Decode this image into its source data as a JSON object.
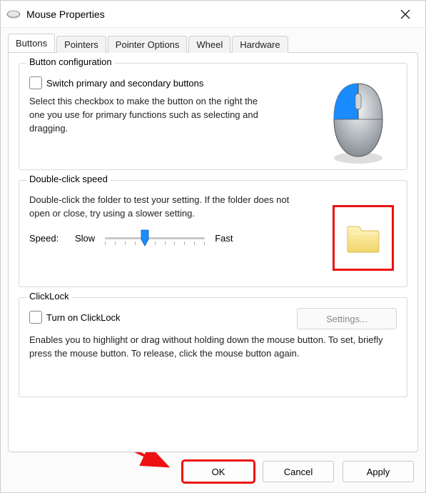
{
  "window": {
    "title": "Mouse Properties"
  },
  "tabs": [
    {
      "label": "Buttons",
      "active": true
    },
    {
      "label": "Pointers"
    },
    {
      "label": "Pointer Options"
    },
    {
      "label": "Wheel"
    },
    {
      "label": "Hardware"
    }
  ],
  "group_button_config": {
    "legend": "Button configuration",
    "checkbox_label": "Switch primary and secondary buttons",
    "checkbox_checked": false,
    "description": "Select this checkbox to make the button on the right the one you use for primary functions such as selecting and dragging."
  },
  "group_doubleclick": {
    "legend": "Double-click speed",
    "description": "Double-click the folder to test your setting. If the folder does not open or close, try using a slower setting.",
    "speed_label": "Speed:",
    "slow_label": "Slow",
    "fast_label": "Fast",
    "slider_value_percent": 40
  },
  "group_clicklock": {
    "legend": "ClickLock",
    "checkbox_label": "Turn on ClickLock",
    "checkbox_checked": false,
    "settings_button": "Settings...",
    "settings_enabled": false,
    "description": "Enables you to highlight or drag without holding down the mouse button. To set, briefly press the mouse button. To release, click the mouse button again."
  },
  "buttons": {
    "ok": "OK",
    "cancel": "Cancel",
    "apply": "Apply"
  },
  "annotations": {
    "folder_highlighted": true,
    "ok_highlighted": true,
    "arrows": 2,
    "arrow_color": "#e11"
  },
  "colors": {
    "accent": "#0a84ff",
    "highlight": "#e11",
    "mouse_button_primary": "#1a8cff"
  }
}
